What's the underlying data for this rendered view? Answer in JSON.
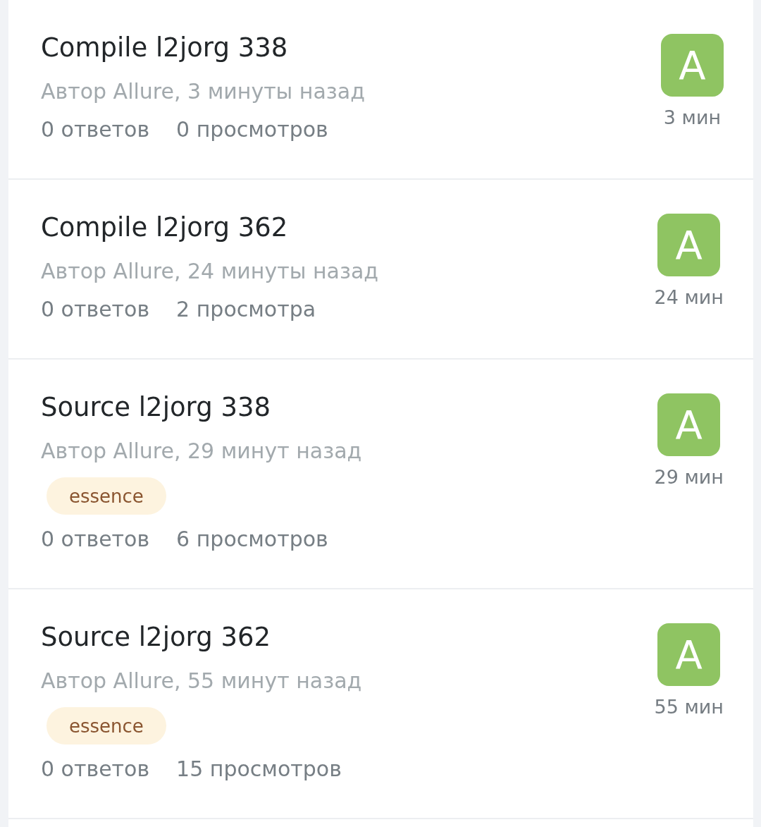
{
  "topics": [
    {
      "title": "Compile l2jorg 338",
      "byline": "Автор Allure, 3 минуты назад",
      "replies": "0 ответов",
      "views": "0 просмотров",
      "avatar_letter": "A",
      "age": "3 мин"
    },
    {
      "title": "Compile l2jorg 362",
      "byline": "Автор Allure, 24 минуты назад",
      "replies": "0 ответов",
      "views": "2 просмотра",
      "avatar_letter": "A",
      "age": "24 мин"
    },
    {
      "title": "Source l2jorg 338",
      "byline": "Автор Allure, 29 минут назад",
      "tags": [
        "essence"
      ],
      "replies": "0 ответов",
      "views": "6 просмотров",
      "avatar_letter": "A",
      "age": "29 мин"
    },
    {
      "title": "Source l2jorg 362",
      "byline": "Автор Allure, 55 минут назад",
      "tags": [
        "essence"
      ],
      "replies": "0 ответов",
      "views": "15 просмотров",
      "avatar_letter": "A",
      "age": "55 мин"
    }
  ]
}
